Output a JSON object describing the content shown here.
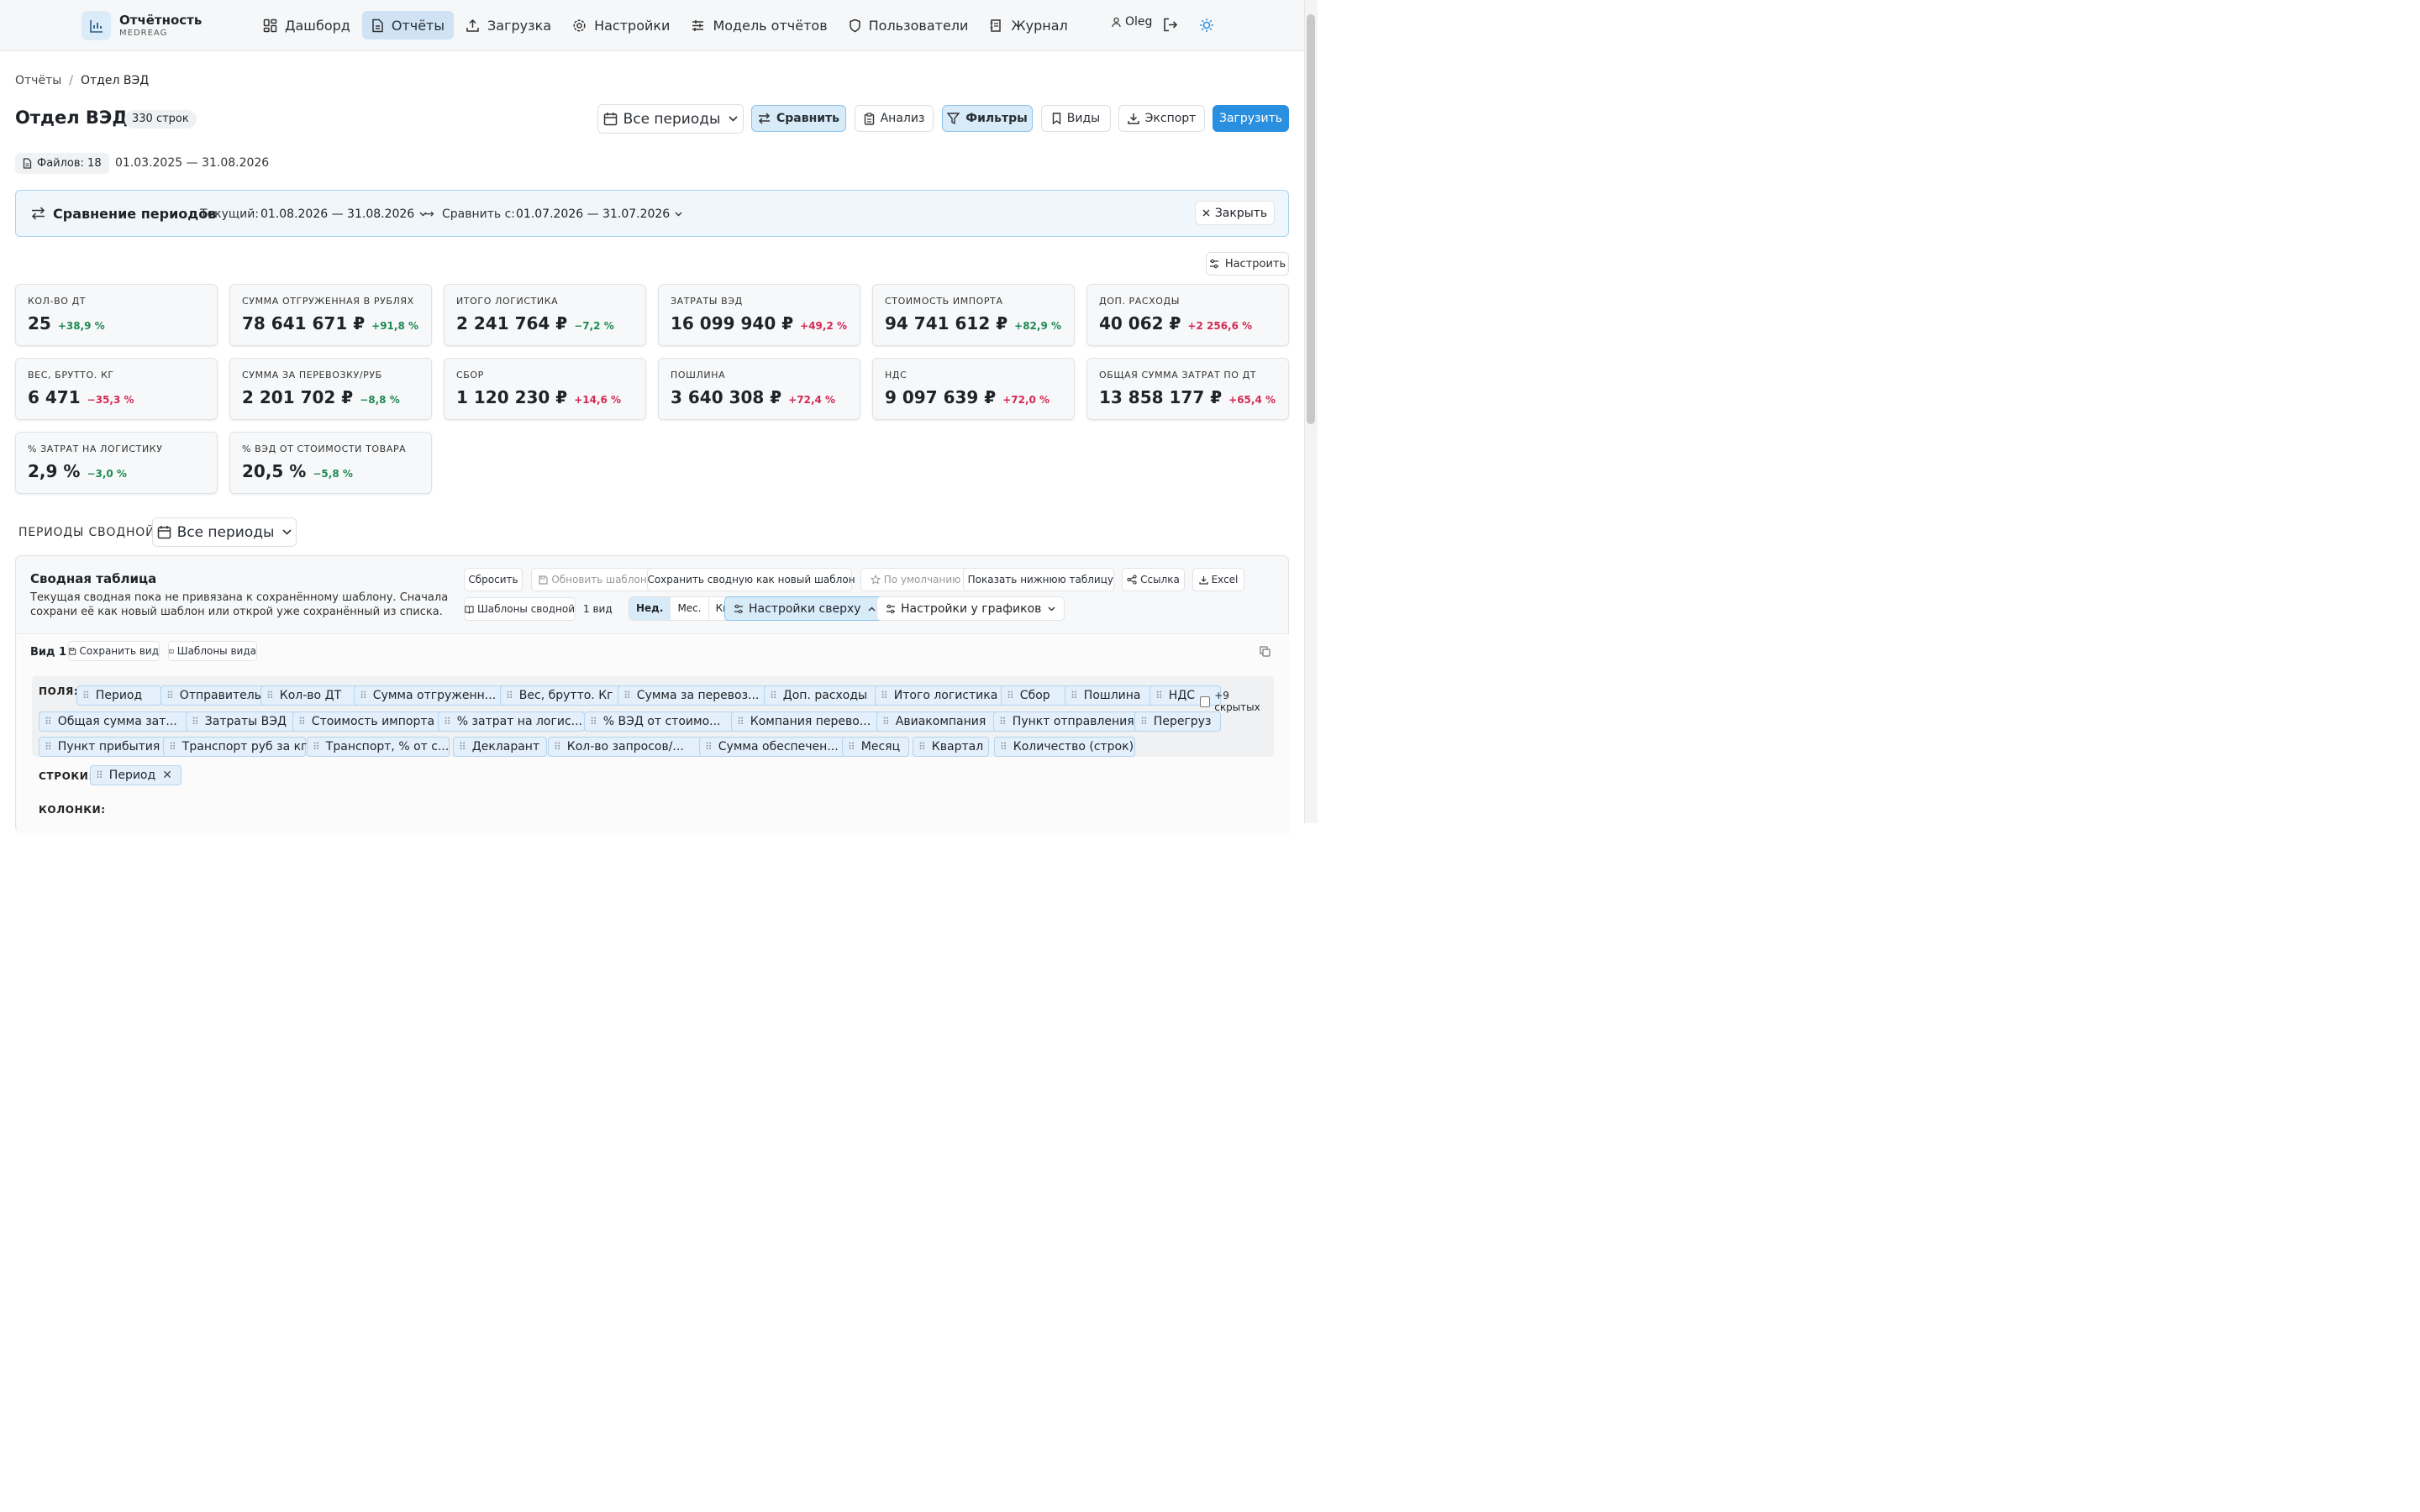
{
  "brand": {
    "title": "Отчётность",
    "subtitle": "MEDREAG"
  },
  "nav": [
    {
      "label": "Дашборд",
      "icon": "dashboard-icon"
    },
    {
      "label": "Отчёты",
      "icon": "document-icon",
      "active": true
    },
    {
      "label": "Загрузка",
      "icon": "upload-icon"
    },
    {
      "label": "Настройки",
      "icon": "gear-icon"
    },
    {
      "label": "Модель отчётов",
      "icon": "sliders-icon"
    },
    {
      "label": "Пользователи",
      "icon": "shield-icon"
    },
    {
      "label": "Журнал",
      "icon": "journal-icon"
    }
  ],
  "user": {
    "name": "Oleg"
  },
  "breadcrumb": {
    "root": "Отчёты",
    "sep": "/",
    "current": "Отдел ВЭД"
  },
  "page": {
    "title": "Отдел ВЭД",
    "rows_badge": "330 строк",
    "files_badge": "Файлов: 18",
    "date_range": "01.03.2025 — 31.08.2026"
  },
  "toolbar": {
    "period": "Все периоды",
    "compare": "Сравнить",
    "analysis": "Анализ",
    "filters": "Фильтры",
    "views": "Виды",
    "export": "Экспорт",
    "upload": "Загрузить"
  },
  "comparison": {
    "title": "Сравнение периодов",
    "current_label": "Текущий:",
    "current_value": "01.08.2026 — 31.08.2026",
    "arrow": "→",
    "compare_label": "Сравнить с:",
    "compare_value": "01.07.2026 — 31.07.2026",
    "close": "Закрыть"
  },
  "configure": "Настроить",
  "kpis": [
    {
      "label": "КОЛ-ВО ДТ",
      "value": "25",
      "delta": "+38,9 %",
      "tone": "good"
    },
    {
      "label": "СУММА ОТГРУЖЕННАЯ В РУБЛЯХ",
      "value": "78 641 671 ₽",
      "delta": "+91,8 %",
      "tone": "good"
    },
    {
      "label": "ИТОГО ЛОГИСТИКА",
      "value": "2 241 764 ₽",
      "delta": "−7,2 %",
      "tone": "good"
    },
    {
      "label": "ЗАТРАТЫ ВЭД",
      "value": "16 099 940 ₽",
      "delta": "+49,2 %",
      "tone": "bad"
    },
    {
      "label": "СТОИМОСТЬ ИМПОРТА",
      "value": "94 741 612 ₽",
      "delta": "+82,9 %",
      "tone": "good"
    },
    {
      "label": "ДОП. РАСХОДЫ",
      "value": "40 062 ₽",
      "delta": "+2 256,6 %",
      "tone": "bad"
    },
    {
      "label": "ВЕС, БРУТТО. КГ",
      "value": "6 471",
      "delta": "−35,3 %",
      "tone": "bad"
    },
    {
      "label": "СУММА ЗА ПЕРЕВОЗКУ/РУБ",
      "value": "2 201 702 ₽",
      "delta": "−8,8 %",
      "tone": "good"
    },
    {
      "label": "СБОР",
      "value": "1 120 230 ₽",
      "delta": "+14,6 %",
      "tone": "bad"
    },
    {
      "label": "ПОШЛИНА",
      "value": "3 640 308 ₽",
      "delta": "+72,4 %",
      "tone": "bad"
    },
    {
      "label": "НДС",
      "value": "9 097 639 ₽",
      "delta": "+72,0 %",
      "tone": "bad"
    },
    {
      "label": "ОБЩАЯ СУММА ЗАТРАТ ПО ДТ",
      "value": "13 858 177 ₽",
      "delta": "+65,4 %",
      "tone": "bad"
    },
    {
      "label": "% ЗАТРАТ НА ЛОГИСТИКУ",
      "value": "2,9 %",
      "delta": "−3,0 %",
      "tone": "good"
    },
    {
      "label": "% ВЭД ОТ СТОИМОСТИ ТОВАРА",
      "value": "20,5 %",
      "delta": "−5,8 %",
      "tone": "good"
    }
  ],
  "colors": {
    "good": "#1f8a54",
    "bad": "#d32a55",
    "accent": "#2b8fe0"
  },
  "pivot_periods": {
    "label": "ПЕРИОДЫ СВОДНОЙ",
    "value": "Все периоды"
  },
  "pivot": {
    "title": "Сводная таблица",
    "desc": "Текущая сводная пока не привязана к сохранённому шаблону. Сначала сохрани её как новый шаблон или открой уже сохранённый из списка.",
    "reset": "Сбросить",
    "update_tpl": "Обновить шаблон",
    "save_new": "Сохранить сводную как новый шаблон",
    "default": "По умолчанию",
    "show_bottom": "Показать нижнюю таблицу",
    "link": "Ссылка",
    "excel": "Excel",
    "templates": "Шаблоны сводной",
    "views_count": "1 вид",
    "seg": [
      "Нед.",
      "Мес.",
      "Кв."
    ],
    "settings_top": "Настройки сверху",
    "settings_charts": "Настройки у графиков",
    "view_name": "Вид 1",
    "save_view": "Сохранить вид",
    "view_templates": "Шаблоны вида",
    "fields_label": "ПОЛЯ:",
    "hidden": "+9 скрытых",
    "rows_label": "СТРОКИ:",
    "rows_chip": "Период",
    "cols_label": "КОЛОНКИ:",
    "fields": [
      "Период",
      "Отправитель",
      "Кол-во ДТ",
      "Сумма отгруженн...",
      "Вес, брутто. Кг",
      "Сумма за перевоз...",
      "Доп. расходы",
      "Итого логистика",
      "Сбор",
      "Пошлина",
      "НДС",
      "Общая сумма зат...",
      "Затраты ВЭД",
      "Стоимость импорта",
      "% затрат на логис...",
      "% ВЭД от стоимо...",
      "Компания перево...",
      "Авиакомпания",
      "Пункт отправления",
      "Перегруз",
      "Пункт прибытия",
      "Транспорт руб за кг",
      "Транспорт, % от с...",
      "Декларант",
      "Кол-во запросов/...",
      "Сумма обеспечен...",
      "Месяц",
      "Квартал",
      "Количество (строк)"
    ]
  }
}
